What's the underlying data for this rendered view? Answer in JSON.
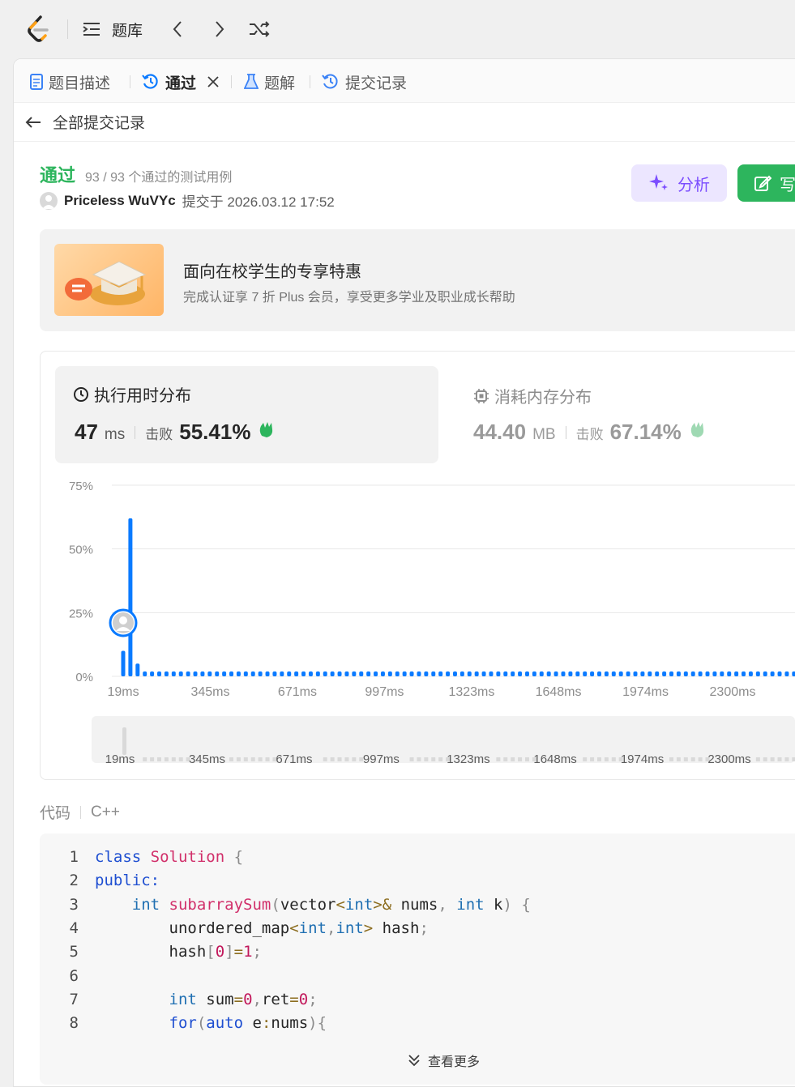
{
  "topbar": {
    "problems_label": "题库"
  },
  "tabs": [
    {
      "label": "题目描述"
    },
    {
      "label": "通过"
    },
    {
      "label": "题解"
    },
    {
      "label": "提交记录"
    }
  ],
  "back": {
    "label": "全部提交记录"
  },
  "submission": {
    "status": "通过",
    "cases": "93 / 93 个通过的测试用例",
    "author": "Priceless WuVYc",
    "submitted_at": "提交于 2026.03.12 17:52"
  },
  "actions": {
    "analyze_label": "分析",
    "write_label": "写"
  },
  "promo": {
    "title": "面向在校学生的专享特惠",
    "subtitle": "完成认证享 7 折 Plus 会员，享受更多学业及职业成长帮助"
  },
  "runtime": {
    "title": "执行用时分布",
    "value": "47",
    "unit": "ms",
    "beat_label": "击败",
    "beat_value": "55.41%"
  },
  "memory": {
    "title": "消耗内存分布",
    "value": "44.40",
    "unit": "MB",
    "beat_label": "击败",
    "beat_value": "67.14%"
  },
  "chart_data": {
    "type": "bar",
    "ytick_labels": [
      "75%",
      "50%",
      "25%",
      "0%"
    ],
    "yticks": [
      75,
      50,
      25,
      0
    ],
    "ylim": [
      0,
      75
    ],
    "xtick_labels": [
      "19ms",
      "345ms",
      "671ms",
      "997ms",
      "1323ms",
      "1648ms",
      "1974ms",
      "2300ms"
    ],
    "xticks": [
      19,
      345,
      671,
      997,
      1323,
      1648,
      1974,
      2300
    ],
    "xlim": [
      0,
      2600
    ],
    "series": [
      {
        "values": [
          [
            19,
            10
          ],
          [
            46,
            62
          ],
          [
            73,
            5
          ]
        ]
      }
    ],
    "baseline_bin_step": 27,
    "baseline_value": 0.8,
    "highlight_x": 19,
    "grid": true,
    "colors": {
      "bar": "#0a7aff",
      "grid": "#e8e8e8",
      "range_bar": "#d9d9d9"
    }
  },
  "code": {
    "label": "代码",
    "language": "C++",
    "lines": [
      {
        "no": "1",
        "tokens": [
          [
            "kw",
            "class"
          ],
          [
            "id",
            " "
          ],
          [
            "fn",
            "Solution"
          ],
          [
            "id",
            " "
          ],
          [
            "pu",
            "{"
          ]
        ]
      },
      {
        "no": "2",
        "tokens": [
          [
            "kw",
            "public"
          ],
          [
            "kw",
            ":"
          ]
        ]
      },
      {
        "no": "3",
        "tokens": [
          [
            "id",
            "    "
          ],
          [
            "ty",
            "int"
          ],
          [
            "id",
            " "
          ],
          [
            "fn",
            "subarraySum"
          ],
          [
            "pu",
            "("
          ],
          [
            "id",
            "vector"
          ],
          [
            "op",
            "<"
          ],
          [
            "ty",
            "int"
          ],
          [
            "op",
            ">&"
          ],
          [
            "id",
            " nums"
          ],
          [
            "pu",
            ","
          ],
          [
            "id",
            " "
          ],
          [
            "ty",
            "int"
          ],
          [
            "id",
            " k"
          ],
          [
            "pu",
            ")"
          ],
          [
            "id",
            " "
          ],
          [
            "pu",
            "{"
          ]
        ]
      },
      {
        "no": "4",
        "tokens": [
          [
            "id",
            "        unordered_map"
          ],
          [
            "op",
            "<"
          ],
          [
            "ty",
            "int"
          ],
          [
            "pu",
            ","
          ],
          [
            "ty",
            "int"
          ],
          [
            "op",
            ">"
          ],
          [
            "id",
            " hash"
          ],
          [
            "pu",
            ";"
          ]
        ]
      },
      {
        "no": "5",
        "tokens": [
          [
            "id",
            "        hash"
          ],
          [
            "pu",
            "["
          ],
          [
            "num",
            "0"
          ],
          [
            "pu",
            "]"
          ],
          [
            "op",
            "="
          ],
          [
            "num",
            "1"
          ],
          [
            "pu",
            ";"
          ]
        ]
      },
      {
        "no": "6",
        "tokens": [
          [
            "id",
            ""
          ]
        ]
      },
      {
        "no": "7",
        "tokens": [
          [
            "id",
            "        "
          ],
          [
            "ty",
            "int"
          ],
          [
            "id",
            " sum"
          ],
          [
            "op",
            "="
          ],
          [
            "num",
            "0"
          ],
          [
            "pu",
            ","
          ],
          [
            "id",
            "ret"
          ],
          [
            "op",
            "="
          ],
          [
            "num",
            "0"
          ],
          [
            "pu",
            ";"
          ]
        ]
      },
      {
        "no": "8",
        "tokens": [
          [
            "id",
            "        "
          ],
          [
            "kw",
            "for"
          ],
          [
            "pu",
            "("
          ],
          [
            "kw",
            "auto"
          ],
          [
            "id",
            " e"
          ],
          [
            "op",
            ":"
          ],
          [
            "id",
            "nums"
          ],
          [
            "pu",
            ")"
          ],
          [
            "pu",
            "{"
          ]
        ]
      }
    ],
    "more_label": "查看更多"
  }
}
